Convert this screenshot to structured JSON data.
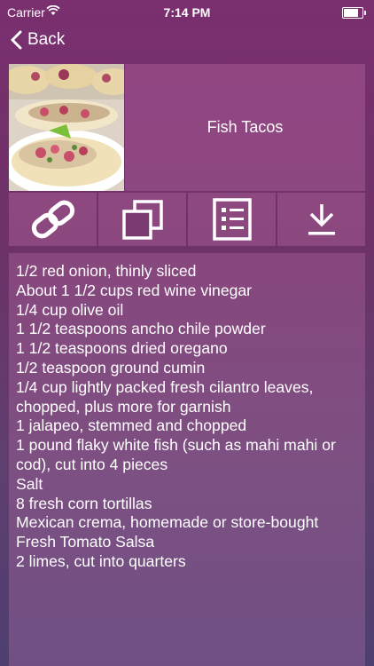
{
  "status_bar": {
    "carrier": "Carrier",
    "time": "7:14 PM"
  },
  "nav": {
    "back_label": "Back"
  },
  "recipe": {
    "title": "Fish Tacos",
    "ingredients": [
      "1/2 red onion, thinly sliced",
      "About 1 1/2 cups red wine vinegar",
      "1/4 cup olive oil",
      "1 1/2 teaspoons ancho chile powder",
      "1 1/2 teaspoons dried oregano",
      "1/2 teaspoon ground cumin",
      "1/4 cup lightly packed fresh cilantro leaves, chopped, plus more for garnish",
      "1 jalapeo, stemmed and chopped",
      "1 pound flaky white fish (such as mahi mahi or cod), cut into 4 pieces",
      "Salt",
      "8 fresh corn tortillas",
      "Mexican crema, homemade or store-bought",
      "Fresh Tomato Salsa",
      "2 limes, cut into quarters"
    ]
  },
  "actions": [
    {
      "icon": "link-icon"
    },
    {
      "icon": "copy-icon"
    },
    {
      "icon": "list-icon"
    },
    {
      "icon": "download-icon"
    }
  ]
}
